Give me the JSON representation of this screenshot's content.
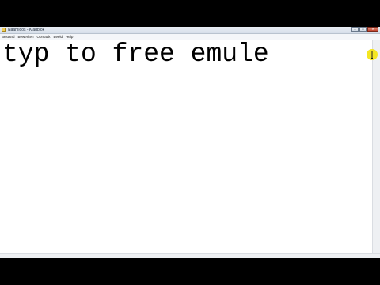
{
  "window": {
    "title": "Naamloos - Kladblok",
    "controls": {
      "minimize": "–",
      "maximize": "□",
      "close": "✕"
    }
  },
  "menu": {
    "items": [
      "Bestand",
      "Bewerken",
      "Opmaak",
      "Beeld",
      "Help"
    ]
  },
  "editor": {
    "content": "typ to free emule"
  },
  "colors": {
    "background": "#000000",
    "editor": "#ffffff",
    "cursor_highlight": "#f3e515"
  },
  "icons": {
    "app": "notepad-icon",
    "pointer": "text-cursor-icon"
  }
}
